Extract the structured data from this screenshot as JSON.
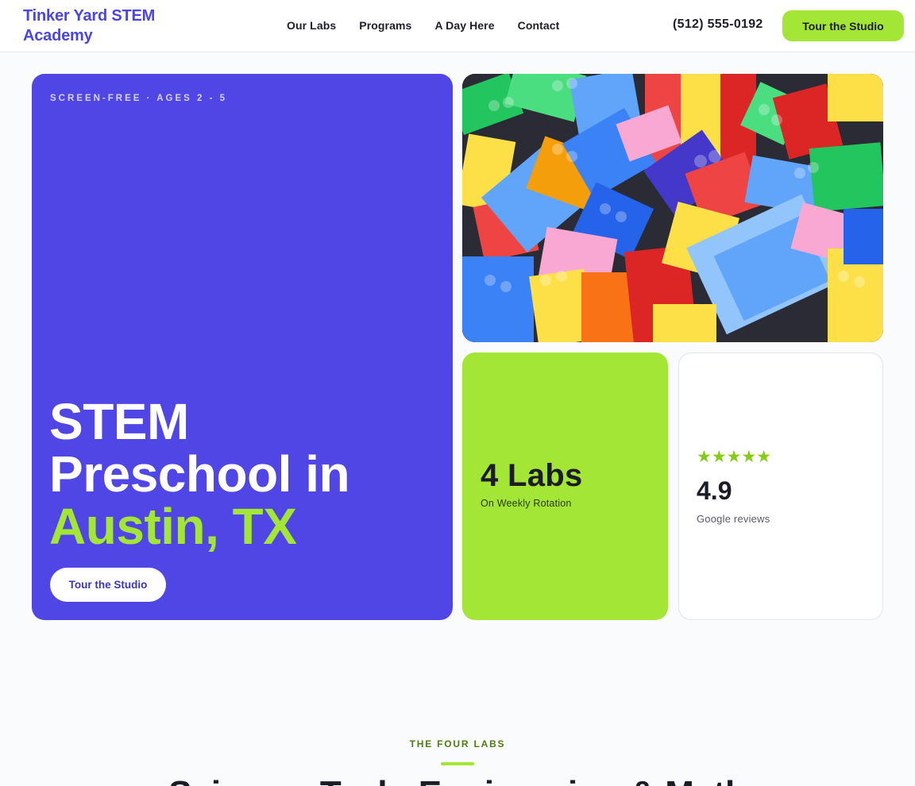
{
  "header": {
    "brand": "Tinker Yard STEM Academy",
    "nav": [
      "Our Labs",
      "Programs",
      "A Day Here",
      "Contact"
    ],
    "phone": "(512) 555-0192",
    "cta": "Tour the Studio"
  },
  "hero": {
    "eyebrow": "SCREEN-FREE · AGES 2 - 5",
    "title_line1": "STEM",
    "title_line2": "Preschool in",
    "title_accent": "Austin, TX",
    "button": "Tour the Studio"
  },
  "photo": {
    "icon": "building-blocks-photo"
  },
  "labs": {
    "value": "4 Labs",
    "label": "On Weekly Rotation"
  },
  "reviews": {
    "stars": "★★★★★",
    "rating": "4.9",
    "label": "Google reviews"
  },
  "section": {
    "eyebrow": "THE FOUR LABS",
    "title": "Science, Tech, Engineering & Math"
  },
  "colors": {
    "primary": "#4f46e5",
    "accent": "#a3e635",
    "background": "#fafbfd"
  }
}
